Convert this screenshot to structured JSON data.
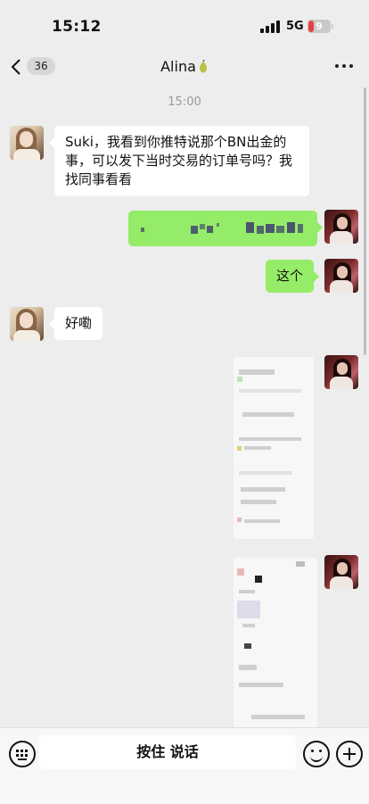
{
  "status_bar": {
    "time": "15:12",
    "network": "5G",
    "battery": "9"
  },
  "header": {
    "unread_count": "36",
    "title": "Alina"
  },
  "chat": {
    "timestamp": "15:00",
    "messages": [
      {
        "side": "in",
        "text": "Suki，我看到你推特说那个BN出金的事，可以发下当时交易的订单号吗？我找同事看看"
      },
      {
        "side": "out",
        "text": ""
      },
      {
        "side": "out",
        "text": "这个"
      },
      {
        "side": "in",
        "text": "好嘞"
      }
    ]
  },
  "input_bar": {
    "hold_to_talk": "按住 说话"
  },
  "colors": {
    "outgoing_bubble": "#95ec69",
    "incoming_bubble": "#ffffff",
    "background": "#ededed",
    "battery_low": "#e34444"
  }
}
